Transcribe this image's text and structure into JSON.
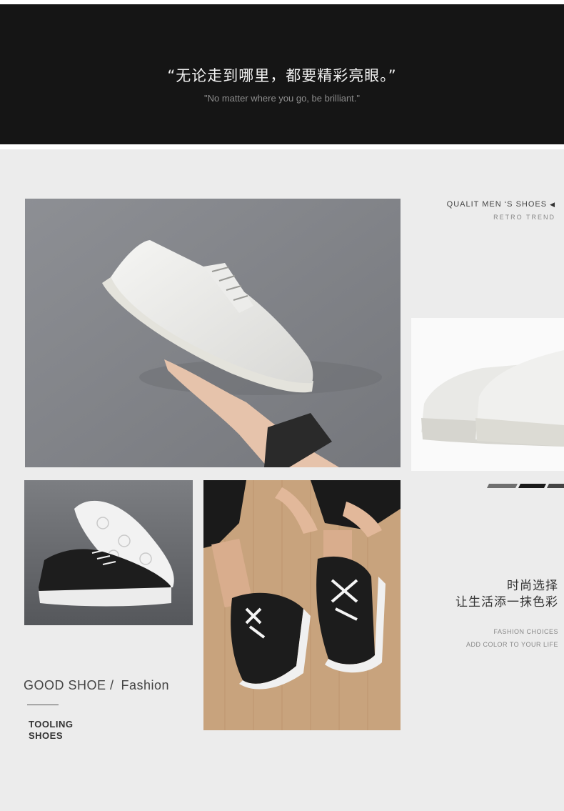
{
  "banner": {
    "quote_cn": "“无论走到哪里，都要精彩亮眼。”",
    "quote_en": "\"No matter where you go, be brilliant.\""
  },
  "side": {
    "quality_title": "QUALIT MEN ‘S SHOES",
    "retro_trend": "RETRO TREND",
    "cn_line1": "时尚选择",
    "cn_line2": "让生活添一抹色彩",
    "en_line1": "FASHION CHOICES",
    "en_line2": "ADD COLOR TO YOUR LIFE"
  },
  "left_caption": {
    "good_shoe": "GOOD SHOE /",
    "fashion": "Fashion",
    "tooling": "TOOLING",
    "shoes": "SHOES"
  },
  "colors": {
    "banner_bg": "#151515",
    "page_bg": "#ececec"
  },
  "icons": {
    "quality_arrow": "triangle-left-icon"
  }
}
